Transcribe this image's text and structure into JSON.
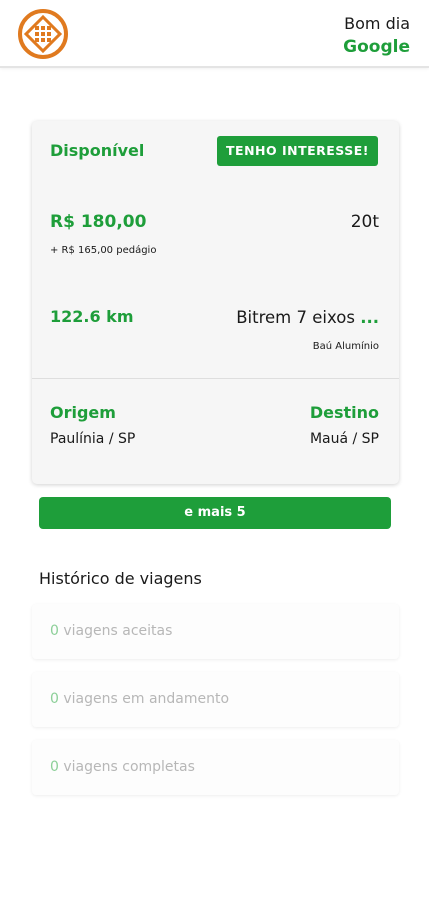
{
  "header": {
    "logo_icon": "orange-circular-lattice-logo",
    "greeting": "Bom dia",
    "username": "Google"
  },
  "freight_card": {
    "status": "Disponível",
    "interest_button": "TENHO INTERESSE!",
    "price": "R$ 180,00",
    "toll": "+ R$ 165,00 pedágio",
    "weight": "20t",
    "distance": "122.6 km",
    "vehicle": "Bitrem 7 eixos",
    "vehicle_more": "...",
    "body_type": "Baú Alumínio",
    "origin_label": "Origem",
    "origin_city": "Paulínia / SP",
    "destination_label": "Destino",
    "destination_city": "Mauá / SP"
  },
  "more_button": "e mais 5",
  "history": {
    "title": "Histórico de viagens",
    "items": [
      {
        "count": "0",
        "label": "viagens aceitas"
      },
      {
        "count": "0",
        "label": "viagens em andamento"
      },
      {
        "count": "0",
        "label": "viagens completas"
      }
    ]
  },
  "colors": {
    "brand_green": "#1e9e3a",
    "logo_orange": "#e07a1f",
    "muted_text": "#b7b7b7"
  }
}
